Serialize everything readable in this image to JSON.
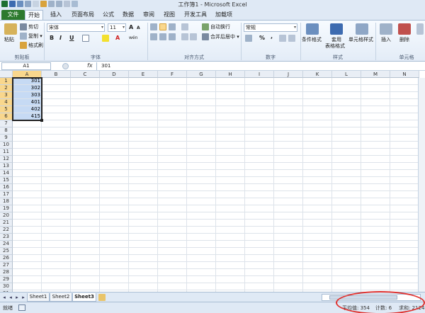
{
  "window": {
    "title": "工作簿1 - Microsoft Excel"
  },
  "tabs": [
    {
      "label": "文件",
      "kind": "file"
    },
    {
      "label": "开始",
      "kind": "active"
    },
    {
      "label": "插入",
      "kind": "normal"
    },
    {
      "label": "页面布局",
      "kind": "normal"
    },
    {
      "label": "公式",
      "kind": "normal"
    },
    {
      "label": "数据",
      "kind": "normal"
    },
    {
      "label": "审阅",
      "kind": "normal"
    },
    {
      "label": "视图",
      "kind": "normal"
    },
    {
      "label": "开发工具",
      "kind": "normal"
    },
    {
      "label": "加载项",
      "kind": "normal"
    }
  ],
  "ribbon": {
    "clipboard": {
      "paste": "粘贴",
      "cut": "剪切",
      "copy": "复制 ▾",
      "format_painter": "格式刷",
      "group": "剪贴板"
    },
    "font": {
      "name": "宋体",
      "size": "11",
      "bold": "B",
      "italic": "I",
      "underline": "U",
      "grow": "A",
      "shrink": "A",
      "wen": "wén",
      "group": "字体"
    },
    "alignment": {
      "wrap": "自动换行",
      "merge": "合并后居中 ▾",
      "group": "对齐方式"
    },
    "number": {
      "format": "常规",
      "percent": "%",
      "comma": ",",
      "group": "数字"
    },
    "styles": {
      "conditional": "条件格式",
      "table_line1": "套用",
      "table_line2": "表格格式",
      "cell_styles": "单元格样式",
      "group": "样式"
    },
    "cells": {
      "insert": "插入",
      "delete": "删除",
      "group": "单元格"
    }
  },
  "formula_bar": {
    "name_box": "A1",
    "fx": "fx",
    "content": "301"
  },
  "columns": [
    "A",
    "B",
    "C",
    "D",
    "E",
    "F",
    "G",
    "H",
    "I",
    "J",
    "K",
    "L",
    "M",
    "N"
  ],
  "rows": [
    "1",
    "2",
    "3",
    "4",
    "5",
    "6",
    "7",
    "8",
    "9",
    "10",
    "11",
    "12",
    "13",
    "14",
    "15",
    "16",
    "17",
    "18",
    "19",
    "20",
    "21",
    "22",
    "23",
    "24",
    "25",
    "26",
    "27",
    "28",
    "29",
    "30",
    "31"
  ],
  "cells": {
    "A1": "301",
    "A2": "302",
    "A3": "303",
    "A4": "401",
    "A5": "402",
    "A6": "415"
  },
  "sheets": [
    "Sheet1",
    "Sheet2",
    "Sheet3"
  ],
  "active_sheet": "Sheet3",
  "status": {
    "ready": "就绪",
    "average": "平均值: 354",
    "count": "计数: 6",
    "sum": "求和: 2124"
  },
  "colors": {
    "file_tab": "#2d7a2e",
    "selection": "#c6daf4",
    "header_selected": "#f9d78d",
    "annotation": "#e0322f"
  }
}
